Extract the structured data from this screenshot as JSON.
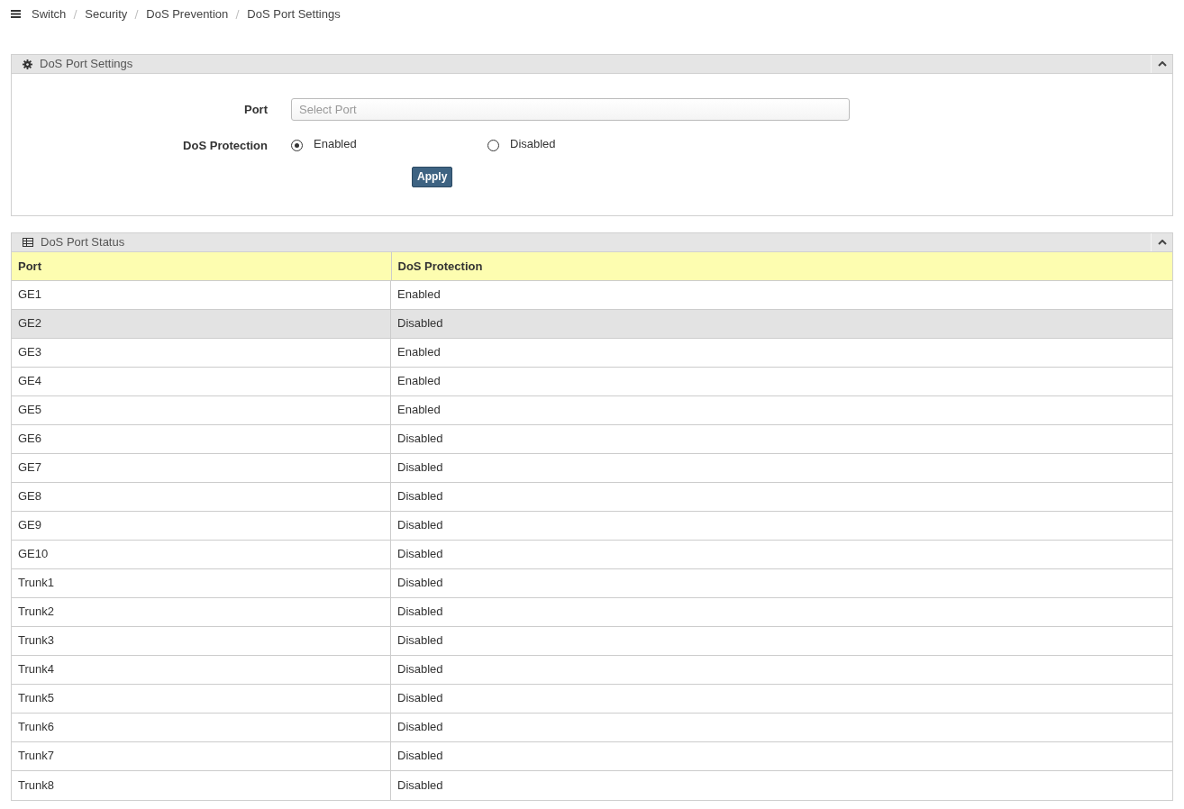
{
  "breadcrumb": [
    "Switch",
    "Security",
    "DoS Prevention",
    "DoS Port Settings"
  ],
  "settings_panel": {
    "title": "DoS Port Settings",
    "port_label": "Port",
    "port_field": {
      "placeholder": "Select Port"
    },
    "protection_label": "DoS Protection",
    "options": [
      {
        "label": "Enabled",
        "selected": true
      },
      {
        "label": "Disabled",
        "selected": false
      }
    ],
    "apply_button": "Apply"
  },
  "status_panel": {
    "title": "DoS Port Status",
    "columns": [
      "Port",
      "DoS Protection"
    ],
    "rows": [
      {
        "port": "GE1",
        "protection": "Enabled",
        "selected": false
      },
      {
        "port": "GE2",
        "protection": "Disabled",
        "selected": true
      },
      {
        "port": "GE3",
        "protection": "Enabled",
        "selected": false
      },
      {
        "port": "GE4",
        "protection": "Enabled",
        "selected": false
      },
      {
        "port": "GE5",
        "protection": "Enabled",
        "selected": false
      },
      {
        "port": "GE6",
        "protection": "Disabled",
        "selected": false
      },
      {
        "port": "GE7",
        "protection": "Disabled",
        "selected": false
      },
      {
        "port": "GE8",
        "protection": "Disabled",
        "selected": false
      },
      {
        "port": "GE9",
        "protection": "Disabled",
        "selected": false
      },
      {
        "port": "GE10",
        "protection": "Disabled",
        "selected": false
      },
      {
        "port": "Trunk1",
        "protection": "Disabled",
        "selected": false
      },
      {
        "port": "Trunk2",
        "protection": "Disabled",
        "selected": false
      },
      {
        "port": "Trunk3",
        "protection": "Disabled",
        "selected": false
      },
      {
        "port": "Trunk4",
        "protection": "Disabled",
        "selected": false
      },
      {
        "port": "Trunk5",
        "protection": "Disabled",
        "selected": false
      },
      {
        "port": "Trunk6",
        "protection": "Disabled",
        "selected": false
      },
      {
        "port": "Trunk7",
        "protection": "Disabled",
        "selected": false
      },
      {
        "port": "Trunk8",
        "protection": "Disabled",
        "selected": false
      }
    ]
  }
}
